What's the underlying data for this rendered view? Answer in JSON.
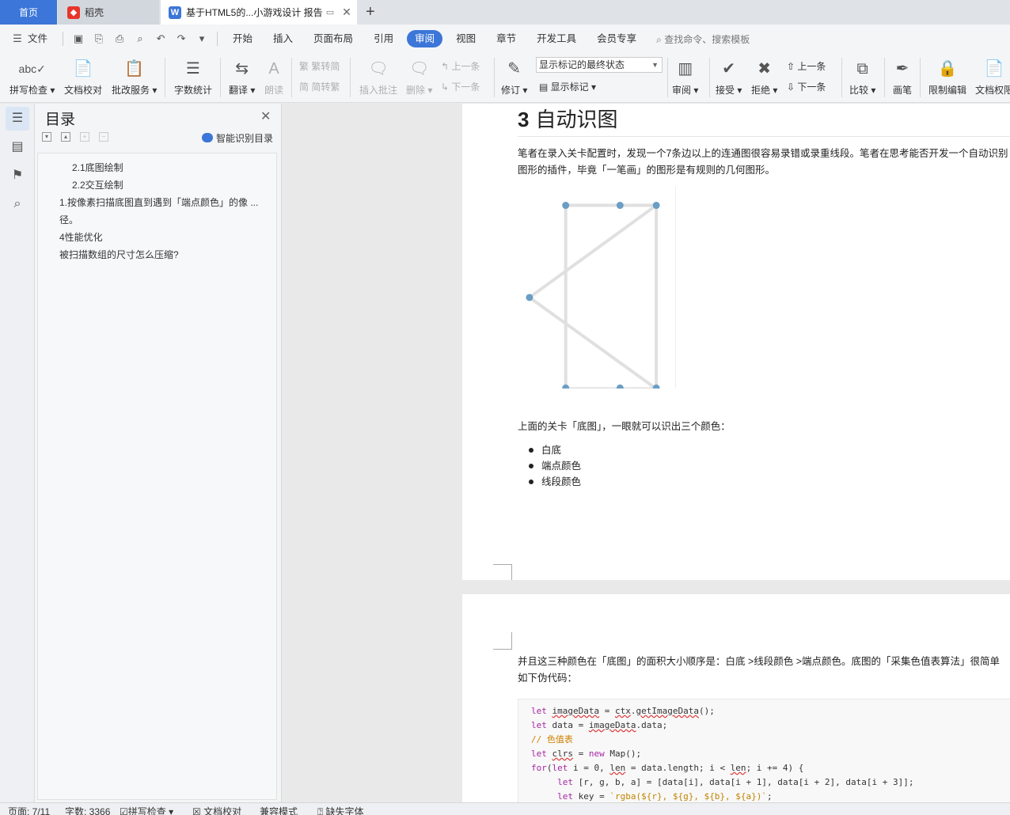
{
  "tabs": {
    "home": "首页",
    "daoke": "稻壳",
    "doc": "基于HTML5的...小游戏设计 报告"
  },
  "menu": {
    "file": "文件",
    "items": [
      "开始",
      "插入",
      "页面布局",
      "引用",
      "审阅",
      "视图",
      "章节",
      "开发工具",
      "会员专享"
    ],
    "active": "审阅",
    "search": "查找命令、搜索模板"
  },
  "ribbon": {
    "spell_check": "拼写检查",
    "doc_proof": "文档校对",
    "correction": "批改服务",
    "word_count": "字数统计",
    "translate": "翻译",
    "read_aloud": "朗读",
    "trad_to_simp": "繁转简",
    "simp_to_trad": "简转繁",
    "insert_comment": "插入批注",
    "delete": "删除",
    "prev_comment": "上一条",
    "next_comment": "下一条",
    "revise": "修订",
    "markup_state": "显示标记的最终状态",
    "show_markup": "显示标记",
    "review": "审阅",
    "accept": "接受",
    "reject": "拒绝",
    "prev_change": "上一条",
    "next_change": "下一条",
    "compare": "比较",
    "pen": "画笔",
    "restrict_edit": "限制编辑",
    "doc_permission": "文档权限"
  },
  "toc": {
    "title": "目录",
    "smart": "智能识别目录",
    "items": [
      "2.1底图绘制",
      "2.2交互绘制",
      "1.按像素扫描底图直到遇到「端点颜色」的像 ...",
      "径。",
      "4性能优化",
      "被扫描数组的尺寸怎么压缩?"
    ]
  },
  "doc": {
    "h3_num": "3",
    "h3_text": "自动识图",
    "para1_line1": "笔者在录入关卡配置时，发现一个7条边以上的连通图很容易录错或录重线段。笔者在思考能否开发一个自动识别",
    "para1_line2": "图形的插件，毕竟「一笔画」的图形是有规则的几何图形。",
    "para2": "上面的关卡「底图」，一眼就可以识出三个颜色：",
    "bullets": [
      "白底",
      "端点颜色",
      "线段颜色"
    ],
    "para3_line1": "并且这三种颜色在「底图」的面积大小顺序是：白底 >线段颜色 >端点颜色。底图的「采集色值表算法」很简单",
    "para3_line2": "如下伪代码："
  },
  "status": {
    "page": "页面: 7/11",
    "words": "字数: 3366",
    "spell": "拼写检查",
    "proof": "文档校对",
    "compat": "兼容模式",
    "missing_font": "缺失字体"
  },
  "colors": {
    "accent": "#3b76d8",
    "node": "#6a9ec4",
    "edge": "#e0e0e0"
  }
}
